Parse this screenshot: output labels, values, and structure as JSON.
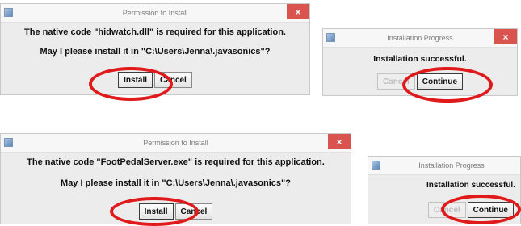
{
  "permission_dialog_1": {
    "title": "Permission to Install",
    "close_glyph": "×",
    "message": "The native code \"hidwatch.dll\" is required for this application.",
    "question": "May I please install it in \"C:\\Users\\Jenna\\.javasonics\"?",
    "install_label": "Install",
    "cancel_label": "Cancel"
  },
  "progress_dialog_1": {
    "title": "Installation Progress",
    "close_glyph": "×",
    "status": "Installation successful.",
    "cancel_label": "Cancel",
    "continue_label": "Continue"
  },
  "permission_dialog_2": {
    "title": "Permission to Install",
    "close_glyph": "×",
    "message": "The native code \"FootPedalServer.exe\" is required for this application.",
    "question": "May I please install it in \"C:\\Users\\Jenna\\.javasonics\"?",
    "install_label": "Install",
    "cancel_label": "Cancel"
  },
  "progress_dialog_2": {
    "title": "Installation Progress",
    "close_glyph": "×",
    "status": "Installation successful.",
    "cancel_label": "Cancel",
    "continue_label": "Continue"
  },
  "colors": {
    "highlight_ring": "#e0191a",
    "close_button": "#d9534f",
    "dialog_bg": "#ececec"
  }
}
